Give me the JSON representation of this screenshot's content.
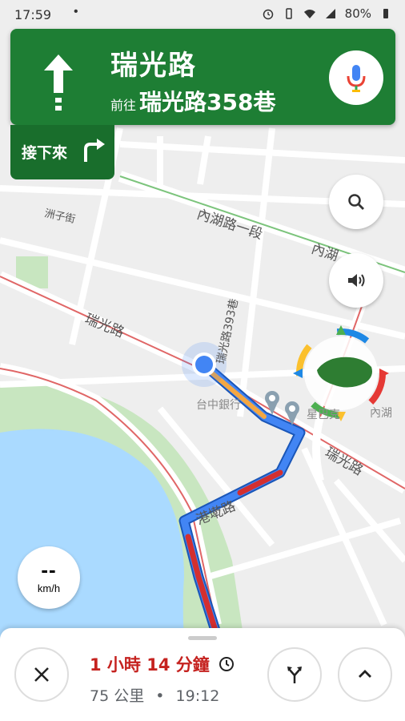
{
  "status_bar": {
    "time": "17:59",
    "dot": "•",
    "battery": "80%"
  },
  "nav": {
    "street": "瑞光路",
    "toward_prefix": "前往",
    "toward": "瑞光路358巷"
  },
  "next_turn": {
    "label": "接下來"
  },
  "map_labels": {
    "neihu_road": "內湖路一段",
    "neihu_road_right": "內湖",
    "zhouzi_st": "洲子街",
    "ruiguang_left": "瑞光路",
    "ruiguang_right": "瑞光路",
    "lane_393": "瑞光路393巷",
    "gangdi_road": "港墘路",
    "bank": "台中銀行",
    "poi2": "星巴克",
    "neihu_right2": "內湖"
  },
  "speed": {
    "value": "--",
    "unit": "km/h"
  },
  "trip": {
    "eta": "1 小時 14 分鐘",
    "distance": "75 公里",
    "arrival": "19:12",
    "separator": "•"
  },
  "icons": [
    "arrow-up-icon",
    "mic-icon",
    "turn-right-icon",
    "search-icon",
    "volume-icon",
    "compass-icon",
    "close-icon",
    "routes-icon",
    "chevron-up-icon"
  ],
  "colors": {
    "nav_green": "#1e7e34",
    "route_blue": "#4285f4",
    "traffic_red": "#d32f2f",
    "eta_red": "#c5221f"
  }
}
